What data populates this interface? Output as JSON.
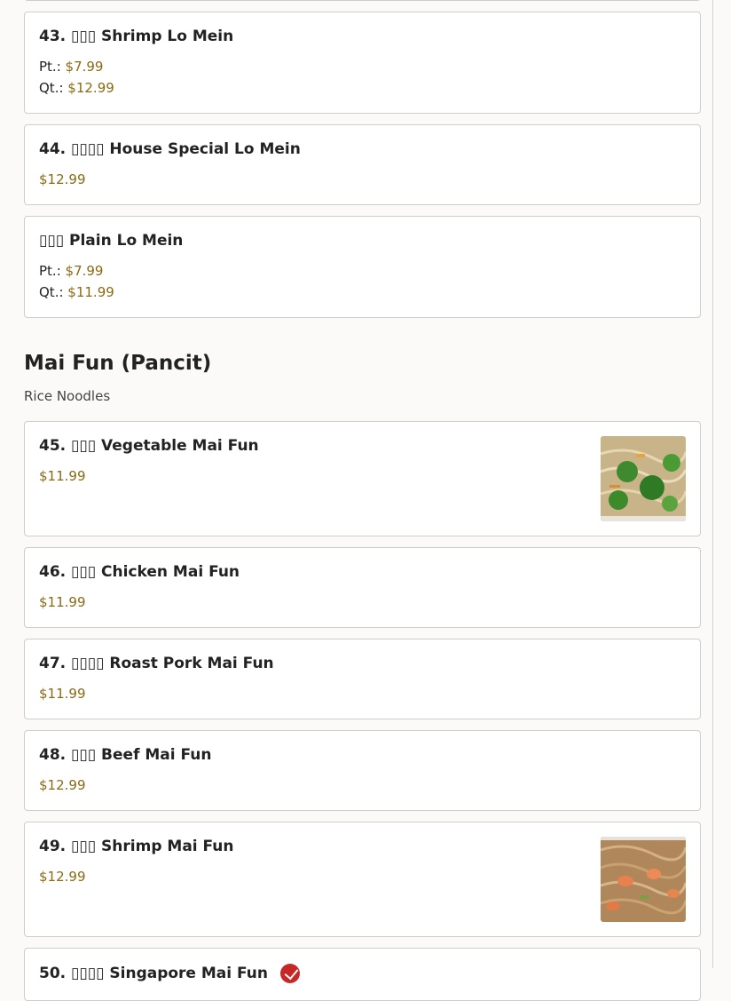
{
  "items": [
    {
      "number": "43.",
      "cn": "▯▯▯",
      "name": "Shrimp Lo Mein",
      "prices": [
        {
          "label": "Pt.:",
          "value": "$7.99"
        },
        {
          "label": "Qt.:",
          "value": "$12.99"
        }
      ]
    },
    {
      "number": "44.",
      "cn": "▯▯▯▯",
      "name": "House Special Lo Mein",
      "price": "$12.99"
    },
    {
      "number": "",
      "cn": "▯▯▯",
      "name": "Plain Lo Mein",
      "prices": [
        {
          "label": "Pt.:",
          "value": "$7.99"
        },
        {
          "label": "Qt.:",
          "value": "$11.99"
        }
      ]
    }
  ],
  "section": {
    "title": "Mai Fun (Pancit)",
    "subtitle": "Rice Noodles"
  },
  "mai_fun": [
    {
      "number": "45.",
      "cn": "▯▯▯",
      "name": "Vegetable Mai Fun",
      "price": "$11.99",
      "image": "vegetable-mai-fun-photo"
    },
    {
      "number": "46.",
      "cn": "▯▯▯",
      "name": "Chicken Mai Fun",
      "price": "$11.99"
    },
    {
      "number": "47.",
      "cn": "▯▯▯▯",
      "name": "Roast Pork Mai Fun",
      "price": "$11.99"
    },
    {
      "number": "48.",
      "cn": "▯▯▯",
      "name": "Beef Mai Fun",
      "price": "$12.99"
    },
    {
      "number": "49.",
      "cn": "▯▯▯",
      "name": "Shrimp Mai Fun",
      "price": "$12.99",
      "image": "shrimp-mai-fun-photo"
    },
    {
      "number": "50.",
      "cn": "▯▯▯▯",
      "name": "Singapore Mai Fun",
      "spicy": true,
      "spicy_icon": "spicy-icon"
    }
  ]
}
